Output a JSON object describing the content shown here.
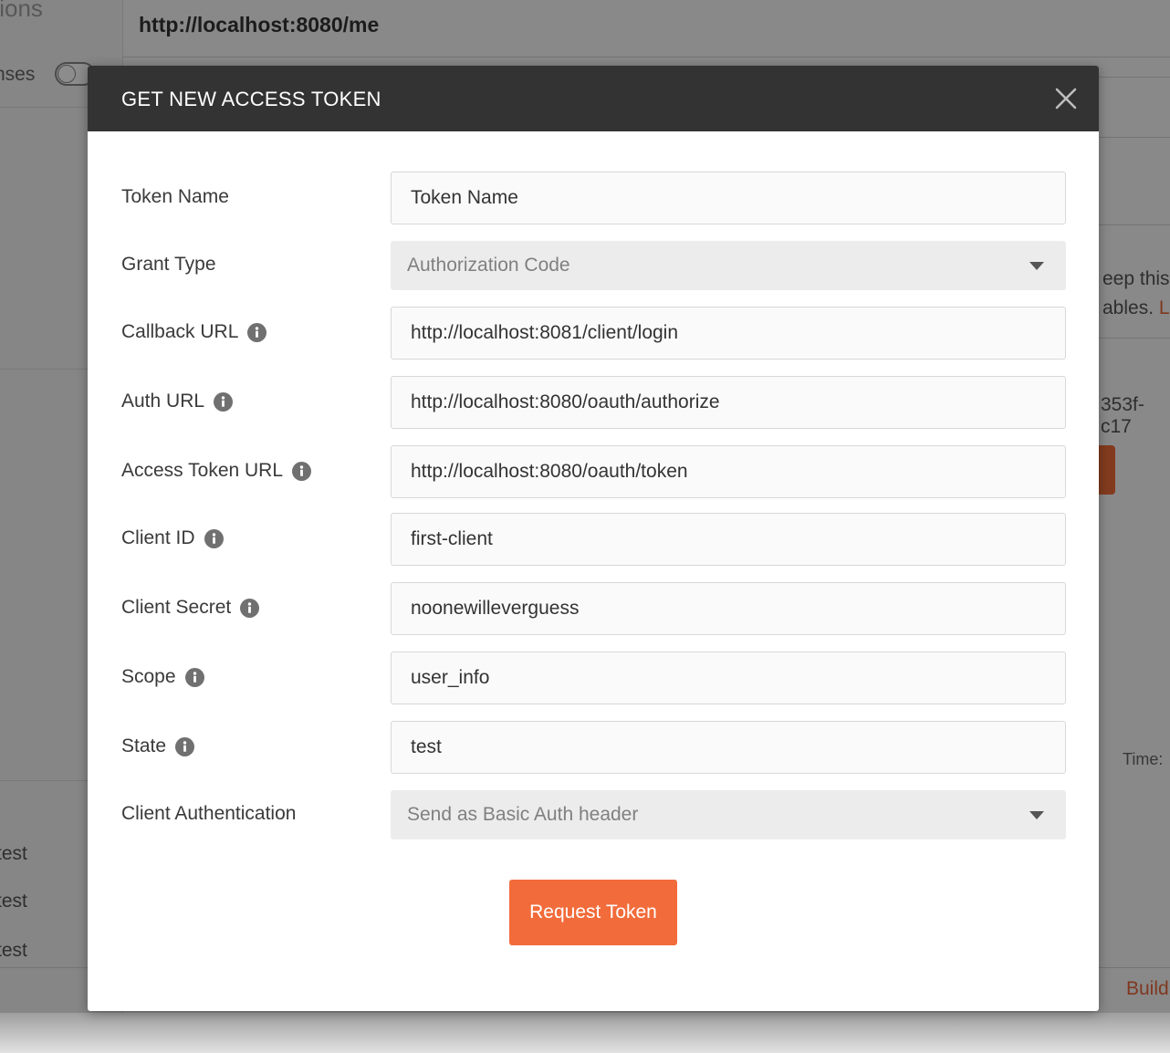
{
  "background": {
    "sidebar_title_fragment": "tions",
    "responses_fragment": "nses",
    "sidebar_items": [
      "test",
      "test",
      "test"
    ],
    "request_url": "http://localhost:8080/me",
    "keep_line1": "eep this",
    "keep_line2": "ables.",
    "learn_fragment": "L",
    "token_fragment": "353f-c17",
    "time_label": "Time:",
    "build_fragment": "Build"
  },
  "modal": {
    "title": "GET NEW ACCESS TOKEN",
    "fields": {
      "token_name": {
        "label": "Token Name",
        "value": "Token Name"
      },
      "grant_type": {
        "label": "Grant Type",
        "value": "Authorization Code"
      },
      "callback_url": {
        "label": "Callback URL",
        "value": "http://localhost:8081/client/login"
      },
      "auth_url": {
        "label": "Auth URL",
        "value": "http://localhost:8080/oauth/authorize"
      },
      "access_token_url": {
        "label": "Access Token URL",
        "value": "http://localhost:8080/oauth/token"
      },
      "client_id": {
        "label": "Client ID",
        "value": "first-client"
      },
      "client_secret": {
        "label": "Client Secret",
        "value": "noonewilleverguess"
      },
      "scope": {
        "label": "Scope",
        "value": "user_info"
      },
      "state": {
        "label": "State",
        "value": "test"
      },
      "client_authentication": {
        "label": "Client Authentication",
        "value": "Send as Basic Auth header"
      }
    },
    "request_button_label": "Request Token"
  },
  "icons": {
    "close": "close-icon",
    "info": "info-icon",
    "dropdown": "chevron-down-icon"
  },
  "colors": {
    "header_bg": "#333333",
    "accent": "#f26b3a",
    "input_bg": "#fafafa",
    "select_bg": "#ececec"
  }
}
